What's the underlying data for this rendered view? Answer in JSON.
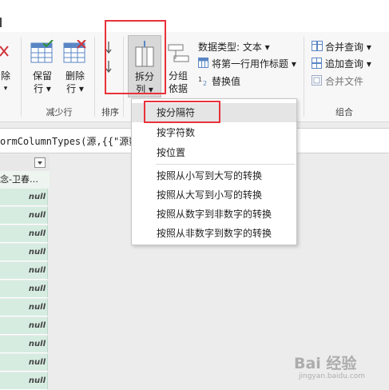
{
  "ribbon": {
    "groups": {
      "reduce_rows": "减少行",
      "sort": "排序",
      "combine": "组合"
    },
    "buttons": {
      "remove_cut": "除",
      "remove_cut_sub": "▾",
      "keep_rows_line1": "保留",
      "keep_rows_line2": "行 ▾",
      "remove_rows_line1": "删除",
      "remove_rows_line2": "行 ▾",
      "split_column_line1": "拆分",
      "split_column_line2": "列 ▾",
      "group_by_line1": "分组",
      "group_by_line2": "依据",
      "data_type": "数据类型: 文本 ▾",
      "first_row_header": "将第一行用作标题 ▾",
      "replace_values": "替换值",
      "merge_queries": "合并查询 ▾",
      "append_queries": "追加查询 ▾",
      "combine_files": "合并文件"
    }
  },
  "formula": {
    "text": "ormColumnTypes(源,{{\"源数"
  },
  "table": {
    "header_cell": "念-卫春…",
    "cells": [
      "null",
      "null",
      "null",
      "null",
      "null",
      "null",
      "null",
      "null",
      "null",
      "null",
      "null"
    ]
  },
  "split_menu": {
    "items": [
      "按分隔符",
      "按字符数",
      "按位置",
      "按照从小写到大写的转换",
      "按照从大写到小写的转换",
      "按照从数字到非数字的转换",
      "按照从非数字到数字的转换"
    ]
  },
  "watermark": {
    "text": "Bai 经验",
    "sub": "jingyan.baidu.com"
  },
  "colors": {
    "accent_red": "#e8323a",
    "table_green": "#d6ece1",
    "menu_highlight": "#e5e5e5"
  }
}
